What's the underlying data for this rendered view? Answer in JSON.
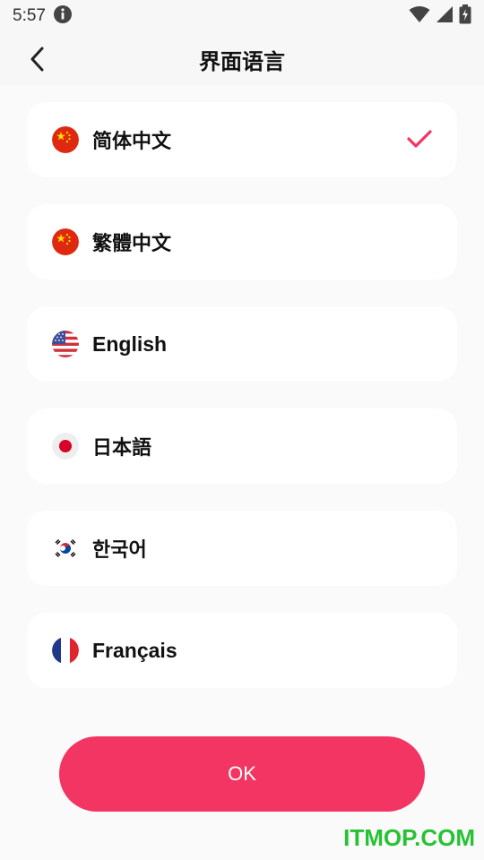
{
  "status_bar": {
    "time": "5:57"
  },
  "header": {
    "title": "界面语言",
    "back_icon": "chevron-left-icon"
  },
  "languages": [
    {
      "label": "简体中文",
      "flag": "china-flag-icon",
      "selected": true
    },
    {
      "label": "繁體中文",
      "flag": "china-flag-icon",
      "selected": false
    },
    {
      "label": "English",
      "flag": "usa-flag-icon",
      "selected": false
    },
    {
      "label": "日本語",
      "flag": "japan-flag-icon",
      "selected": false
    },
    {
      "label": "한국어",
      "flag": "korea-flag-icon",
      "selected": false
    },
    {
      "label": "Français",
      "flag": "france-flag-icon",
      "selected": false
    }
  ],
  "ok_button": {
    "label": "OK"
  },
  "watermark": "ITMOP.COM",
  "colors": {
    "accent": "#f23562",
    "background": "#f7f7f7",
    "card": "#ffffff",
    "watermark": "#27c233"
  }
}
